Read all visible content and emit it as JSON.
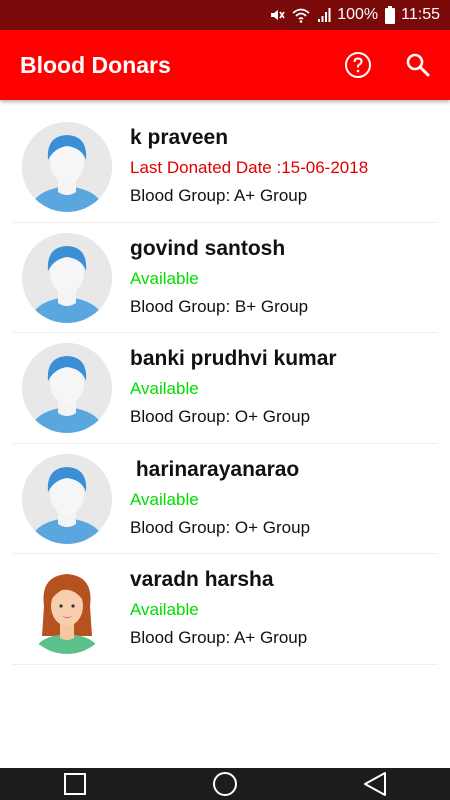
{
  "status_bar": {
    "battery_text": "100%",
    "time": "11:55",
    "icons": [
      "mute-icon",
      "wifi-icon",
      "signal-icon",
      "battery-icon"
    ]
  },
  "app_bar": {
    "title": "Blood Donars",
    "background_color": "#ff0000",
    "actions": [
      "help-icon",
      "search-icon"
    ]
  },
  "colors": {
    "available": "#00dd00",
    "last_donated": "#e00000",
    "status_bar": "#7a0a0a"
  },
  "donors": [
    {
      "name": "k praveen",
      "status": "Last Donated Date :15-06-2018",
      "status_type": "last_donated",
      "blood_group": "Blood Group: A+ Group",
      "avatar": "male-avatar-icon"
    },
    {
      "name": "govind santosh",
      "status": "Available",
      "status_type": "available",
      "blood_group": "Blood Group: B+ Group",
      "avatar": "male-avatar-icon"
    },
    {
      "name": "banki prudhvi kumar",
      "status": "Available",
      "status_type": "available",
      "blood_group": "Blood Group: O+ Group",
      "avatar": "male-avatar-icon"
    },
    {
      "name": " harinarayanarao",
      "status": "Available",
      "status_type": "available",
      "blood_group": "Blood Group: O+ Group",
      "avatar": "male-avatar-icon"
    },
    {
      "name": "varadn harsha",
      "status": "Available",
      "status_type": "available",
      "blood_group": "Blood Group: A+ Group",
      "avatar": "female-avatar-icon"
    }
  ],
  "nav_bar": {
    "buttons": [
      "recents-square-icon",
      "home-circle-icon",
      "back-triangle-icon"
    ]
  }
}
